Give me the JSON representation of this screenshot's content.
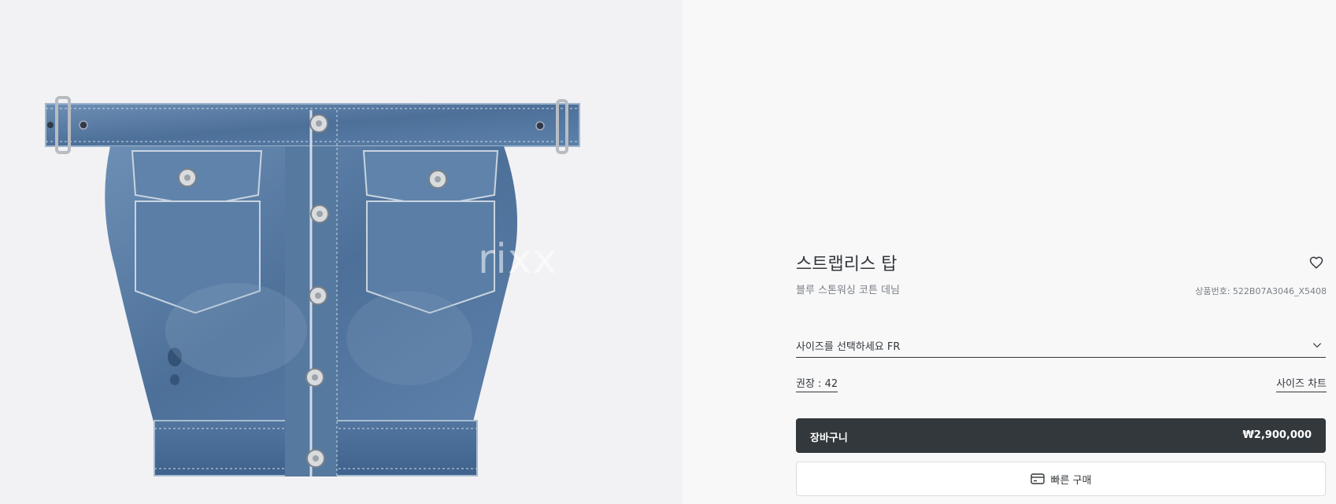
{
  "product": {
    "title": "스트랩리스 탑",
    "subtitle": "블루 스톤워싱 코튼 데님",
    "reference": "상품번호: 522B07A3046_X5408",
    "image_alt": "denim strapless top with belt and pockets"
  },
  "size": {
    "select_label": "사이즈를 선택하세요 FR",
    "recommendation": "권장 : 42",
    "chart_link": "사이즈 차트"
  },
  "actions": {
    "cart_label": "장바구니",
    "cart_price": "₩2,900,000",
    "quick_buy_label": "빠른 구매"
  },
  "watermark": {
    "text": "rixx"
  },
  "icons": {
    "favorite": "heart-icon",
    "dropdown": "chevron-down-icon",
    "quick_buy": "credit-card-icon"
  },
  "colors": {
    "primary_dark": "#33383c",
    "muted_text": "#7b8087",
    "gallery_bg": "#f2f2f4",
    "denim": "#5b7fa6"
  }
}
